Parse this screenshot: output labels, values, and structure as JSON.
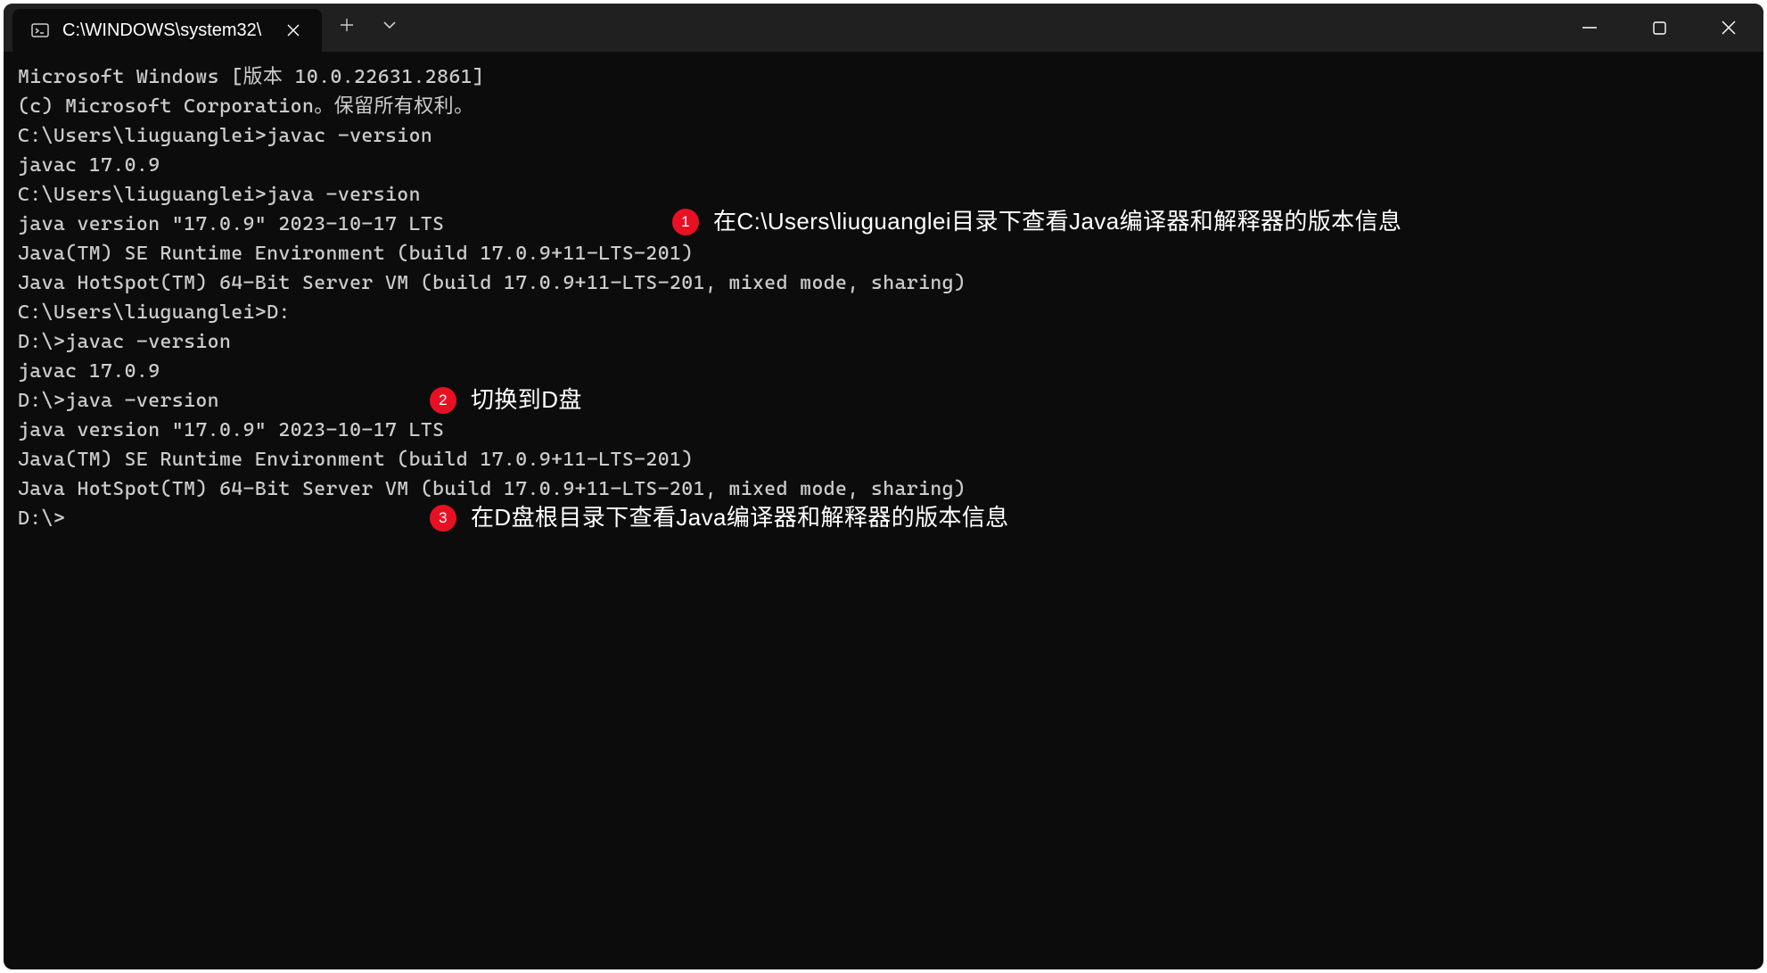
{
  "window": {
    "tab_title": "C:\\WINDOWS\\system32\\"
  },
  "terminal": {
    "lines": [
      "Microsoft Windows [版本 10.0.22631.2861]",
      "(c) Microsoft Corporation。保留所有权利。",
      "",
      "C:\\Users\\liuguanglei>javac -version",
      "javac 17.0.9",
      "",
      "C:\\Users\\liuguanglei>java -version",
      "java version \"17.0.9\" 2023-10-17 LTS",
      "Java(TM) SE Runtime Environment (build 17.0.9+11-LTS-201)",
      "Java HotSpot(TM) 64-Bit Server VM (build 17.0.9+11-LTS-201, mixed mode, sharing)",
      "",
      "C:\\Users\\liuguanglei>D:",
      "",
      "D:\\>javac -version",
      "javac 17.0.9",
      "",
      "D:\\>java -version",
      "java version \"17.0.9\" 2023-10-17 LTS",
      "Java(TM) SE Runtime Environment (build 17.0.9+11-LTS-201)",
      "Java HotSpot(TM) 64-Bit Server VM (build 17.0.9+11-LTS-201, mixed mode, sharing)",
      "",
      "D:\\>"
    ]
  },
  "annotations": [
    {
      "badge": "1",
      "text": "在C:\\Users\\liuguanglei目录下查看Java编译器和解释器的版本信息"
    },
    {
      "badge": "2",
      "text": "切换到D盘"
    },
    {
      "badge": "3",
      "text": "在D盘根目录下查看Java编译器和解释器的版本信息"
    }
  ]
}
